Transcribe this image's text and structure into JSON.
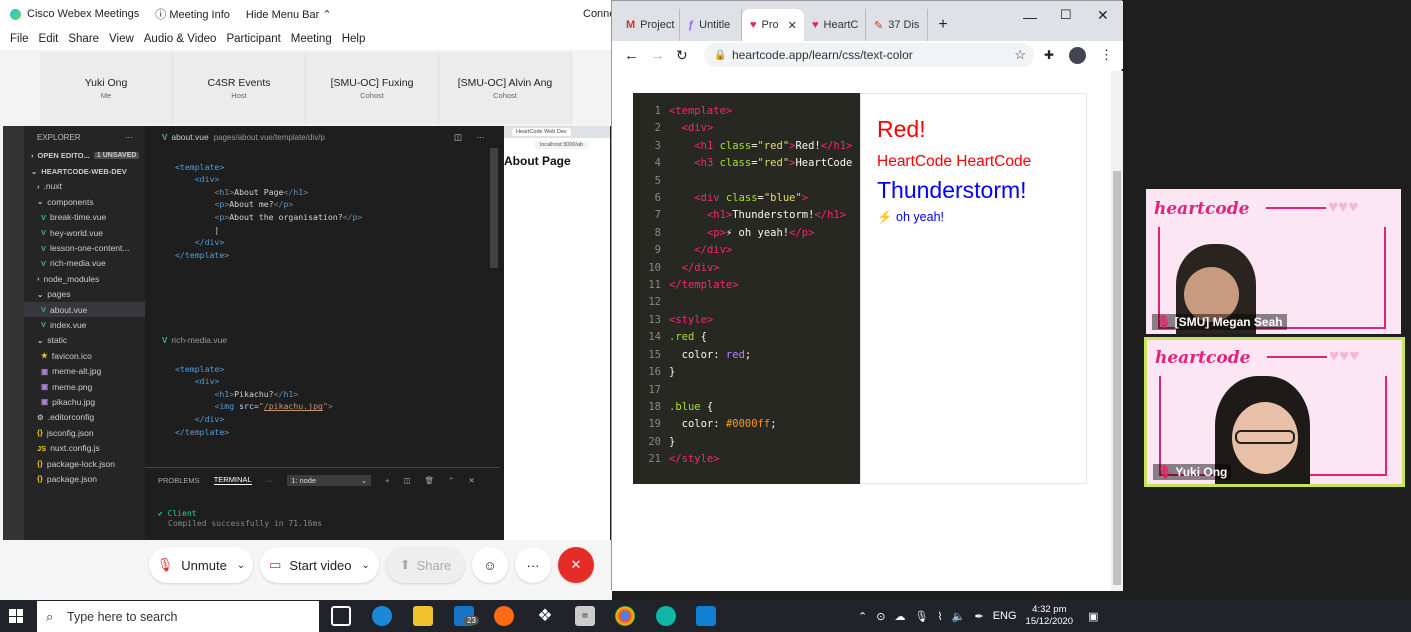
{
  "webex": {
    "app_title": "Cisco Webex Meetings",
    "meeting_info": "Meeting Info",
    "hide_menu": "Hide Menu Bar",
    "conn": "Conne",
    "menu": [
      "File",
      "Edit",
      "Share",
      "View",
      "Audio & Video",
      "Participant",
      "Meeting",
      "Help"
    ],
    "participants": [
      {
        "name": "Yuki Ong",
        "role": "Me"
      },
      {
        "name": "C4SR Events",
        "role": "Host"
      },
      {
        "name": "[SMU-OC] Fuxing",
        "role": "Cohost"
      },
      {
        "name": "[SMU-OC] Alvin Ang",
        "role": "Cohost"
      }
    ],
    "controls": {
      "unmute": "Unmute",
      "start_video": "Start video",
      "share": "Share"
    }
  },
  "vscode": {
    "explorer": "EXPLORER",
    "open_editors": "OPEN EDITO...",
    "unsaved": "1 UNSAVED",
    "project": "HEARTCODE-WEB-DEV",
    "tree": [
      {
        "label": ".nuxt",
        "kind": "folder",
        "level": 1
      },
      {
        "label": "components",
        "kind": "folder-open",
        "level": 1
      },
      {
        "label": "break-time.vue",
        "kind": "vue",
        "level": 2
      },
      {
        "label": "hey-world.vue",
        "kind": "vue",
        "level": 2
      },
      {
        "label": "lesson-one-content...",
        "kind": "vue",
        "level": 2
      },
      {
        "label": "rich-media.vue",
        "kind": "vue",
        "level": 2
      },
      {
        "label": "node_modules",
        "kind": "folder",
        "level": 1
      },
      {
        "label": "pages",
        "kind": "folder-open",
        "level": 1
      },
      {
        "label": "about.vue",
        "kind": "vue",
        "level": 2,
        "selected": true
      },
      {
        "label": "index.vue",
        "kind": "vue",
        "level": 2
      },
      {
        "label": "static",
        "kind": "folder-open",
        "level": 1
      },
      {
        "label": "favicon.ico",
        "kind": "star",
        "level": 2
      },
      {
        "label": "meme-alt.jpg",
        "kind": "img",
        "level": 2
      },
      {
        "label": "meme.png",
        "kind": "img",
        "level": 2
      },
      {
        "label": "pikachu.jpg",
        "kind": "img",
        "level": 2
      },
      {
        "label": ".editorconfig",
        "kind": "gear",
        "level": 1
      },
      {
        "label": "jsconfig.json",
        "kind": "json",
        "level": 1
      },
      {
        "label": "nuxt.config.js",
        "kind": "js",
        "level": 1
      },
      {
        "label": "package-lock.json",
        "kind": "json",
        "level": 1
      },
      {
        "label": "package.json",
        "kind": "json",
        "level": 1
      }
    ],
    "editor1": {
      "filename": "about.vue",
      "breadcrumb": "pages/about.vue/template/div/p"
    },
    "editor2": {
      "filename": "rich-media.vue"
    },
    "terminal": {
      "tabs": [
        "PROBLEMS",
        "TERMINAL"
      ],
      "select": "1: node",
      "line1": "✔ Client",
      "line2": "Compiled successfully in 71.16ms"
    },
    "mini_browser": {
      "tab": "HeartCode Web Dev",
      "url": "localhost:3000/ab",
      "heading": "About Page"
    }
  },
  "chrome": {
    "tabs": [
      "Project",
      "Untitle",
      "Pro",
      "HeartC",
      "37 Dis"
    ],
    "url": "heartcode.app/learn/css/text-color"
  },
  "lesson": {
    "line_numbers": [
      "1",
      "2",
      "3",
      "4",
      "5",
      "6",
      "7",
      "8",
      "9",
      "10",
      "11",
      "12",
      "13",
      "14",
      "15",
      "16",
      "17",
      "18",
      "19",
      "20",
      "21"
    ],
    "preview": {
      "red1": "Red!",
      "red2": "HeartCode HeartCode",
      "blue1": "Thunderstorm!",
      "blue2": "⚡ oh yeah!"
    }
  },
  "videos": [
    {
      "name": "[SMU] Megan Seah"
    },
    {
      "name": "Yuki Ong"
    }
  ],
  "taskbar": {
    "search": "Type here to search",
    "mail_badge": "23",
    "lang": "ENG",
    "time": "4:32 pm",
    "date": "15/12/2020"
  }
}
